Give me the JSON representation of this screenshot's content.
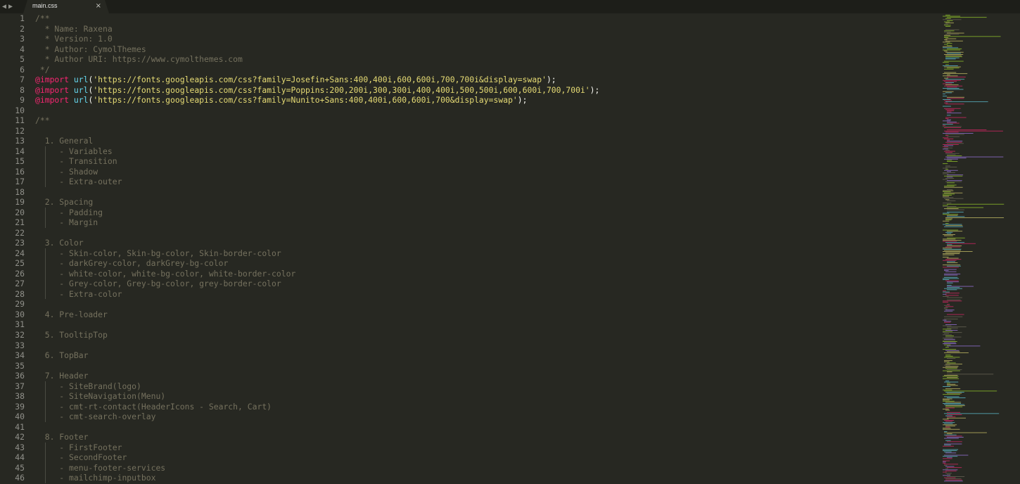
{
  "tabbar": {
    "back_arrow": "◀",
    "forward_arrow": "▶",
    "tab": {
      "title": "main.css",
      "close_icon": "×"
    }
  },
  "colors": {
    "background": "#272822",
    "comment": "#75715e",
    "keyword": "#f92672",
    "function": "#66d9ef",
    "string": "#e6db74",
    "plain": "#f8f8f2",
    "line_number": "#90908a"
  },
  "lines": [
    {
      "n": "1",
      "tokens": [
        {
          "t": "cm",
          "v": "/**"
        }
      ]
    },
    {
      "n": "2",
      "tokens": [
        {
          "t": "cm",
          "v": "  * Name: Raxena"
        }
      ]
    },
    {
      "n": "3",
      "tokens": [
        {
          "t": "cm",
          "v": "  * Version: 1.0"
        }
      ]
    },
    {
      "n": "4",
      "tokens": [
        {
          "t": "cm",
          "v": "  * Author: CymolThemes"
        }
      ]
    },
    {
      "n": "5",
      "tokens": [
        {
          "t": "cm",
          "v": "  * Author URI: https://www.cymolthemes.com"
        }
      ]
    },
    {
      "n": "6",
      "tokens": [
        {
          "t": "cm",
          "v": " */"
        }
      ]
    },
    {
      "n": "7",
      "tokens": [
        {
          "t": "at",
          "v": "@import"
        },
        {
          "t": "pl",
          "v": " "
        },
        {
          "t": "fn",
          "v": "url"
        },
        {
          "t": "pl",
          "v": "("
        },
        {
          "t": "st",
          "v": "'https://fonts.googleapis.com/css?family=Josefin+Sans:400,400i,600,600i,700,700i&display=swap'"
        },
        {
          "t": "pl",
          "v": ");"
        }
      ]
    },
    {
      "n": "8",
      "tokens": [
        {
          "t": "at",
          "v": "@import"
        },
        {
          "t": "pl",
          "v": " "
        },
        {
          "t": "fn",
          "v": "url"
        },
        {
          "t": "pl",
          "v": "("
        },
        {
          "t": "st",
          "v": "'https://fonts.googleapis.com/css?family=Poppins:200,200i,300,300i,400,400i,500,500i,600,600i,700,700i'"
        },
        {
          "t": "pl",
          "v": ");"
        }
      ]
    },
    {
      "n": "9",
      "tokens": [
        {
          "t": "at",
          "v": "@import"
        },
        {
          "t": "pl",
          "v": " "
        },
        {
          "t": "fn",
          "v": "url"
        },
        {
          "t": "pl",
          "v": "("
        },
        {
          "t": "st",
          "v": "'https://fonts.googleapis.com/css?family=Nunito+Sans:400,400i,600,600i,700&display=swap'"
        },
        {
          "t": "pl",
          "v": ");"
        }
      ]
    },
    {
      "n": "10",
      "tokens": []
    },
    {
      "n": "11",
      "tokens": [
        {
          "t": "cm",
          "v": "/**"
        }
      ]
    },
    {
      "n": "12",
      "tokens": []
    },
    {
      "n": "13",
      "tokens": [
        {
          "t": "cm",
          "v": "  1. General"
        }
      ]
    },
    {
      "n": "14",
      "tokens": [
        {
          "t": "cm",
          "v": "     - Variables"
        }
      ],
      "guide": true
    },
    {
      "n": "15",
      "tokens": [
        {
          "t": "cm",
          "v": "     - Transition"
        }
      ],
      "guide": true
    },
    {
      "n": "16",
      "tokens": [
        {
          "t": "cm",
          "v": "     - Shadow"
        }
      ],
      "guide": true
    },
    {
      "n": "17",
      "tokens": [
        {
          "t": "cm",
          "v": "     - Extra-outer"
        }
      ],
      "guide": true
    },
    {
      "n": "18",
      "tokens": []
    },
    {
      "n": "19",
      "tokens": [
        {
          "t": "cm",
          "v": "  2. Spacing"
        }
      ]
    },
    {
      "n": "20",
      "tokens": [
        {
          "t": "cm",
          "v": "     - Padding"
        }
      ],
      "guide": true
    },
    {
      "n": "21",
      "tokens": [
        {
          "t": "cm",
          "v": "     - Margin"
        }
      ],
      "guide": true
    },
    {
      "n": "22",
      "tokens": []
    },
    {
      "n": "23",
      "tokens": [
        {
          "t": "cm",
          "v": "  3. Color"
        }
      ]
    },
    {
      "n": "24",
      "tokens": [
        {
          "t": "cm",
          "v": "     - Skin-color, Skin-bg-color, Skin-border-color"
        }
      ],
      "guide": true
    },
    {
      "n": "25",
      "tokens": [
        {
          "t": "cm",
          "v": "     - darkGrey-color, darkGrey-bg-color"
        }
      ],
      "guide": true
    },
    {
      "n": "26",
      "tokens": [
        {
          "t": "cm",
          "v": "     - white-color, white-bg-color, white-border-color"
        }
      ],
      "guide": true
    },
    {
      "n": "27",
      "tokens": [
        {
          "t": "cm",
          "v": "     - Grey-color, Grey-bg-color, grey-border-color"
        }
      ],
      "guide": true
    },
    {
      "n": "28",
      "tokens": [
        {
          "t": "cm",
          "v": "     - Extra-color"
        }
      ],
      "guide": true
    },
    {
      "n": "29",
      "tokens": []
    },
    {
      "n": "30",
      "tokens": [
        {
          "t": "cm",
          "v": "  4. Pre-loader"
        }
      ]
    },
    {
      "n": "31",
      "tokens": []
    },
    {
      "n": "32",
      "tokens": [
        {
          "t": "cm",
          "v": "  5. TooltipTop"
        }
      ]
    },
    {
      "n": "33",
      "tokens": []
    },
    {
      "n": "34",
      "tokens": [
        {
          "t": "cm",
          "v": "  6. TopBar"
        }
      ]
    },
    {
      "n": "35",
      "tokens": []
    },
    {
      "n": "36",
      "tokens": [
        {
          "t": "cm",
          "v": "  7. Header"
        }
      ]
    },
    {
      "n": "37",
      "tokens": [
        {
          "t": "cm",
          "v": "     - SiteBrand(logo)"
        }
      ],
      "guide": true
    },
    {
      "n": "38",
      "tokens": [
        {
          "t": "cm",
          "v": "     - SiteNavigation(Menu)"
        }
      ],
      "guide": true
    },
    {
      "n": "39",
      "tokens": [
        {
          "t": "cm",
          "v": "     - cmt-rt-contact(HeaderIcons - Search, Cart)"
        }
      ],
      "guide": true
    },
    {
      "n": "40",
      "tokens": [
        {
          "t": "cm",
          "v": "     - cmt-search-overlay"
        }
      ],
      "guide": true
    },
    {
      "n": "41",
      "tokens": []
    },
    {
      "n": "42",
      "tokens": [
        {
          "t": "cm",
          "v": "  8. Footer"
        }
      ]
    },
    {
      "n": "43",
      "tokens": [
        {
          "t": "cm",
          "v": "     - FirstFooter"
        }
      ],
      "guide": true
    },
    {
      "n": "44",
      "tokens": [
        {
          "t": "cm",
          "v": "     - SecondFooter"
        }
      ],
      "guide": true
    },
    {
      "n": "45",
      "tokens": [
        {
          "t": "cm",
          "v": "     - menu-footer-services"
        }
      ],
      "guide": true
    },
    {
      "n": "46",
      "tokens": [
        {
          "t": "cm",
          "v": "     - mailchimp-inputbox"
        }
      ],
      "guide": true
    }
  ]
}
